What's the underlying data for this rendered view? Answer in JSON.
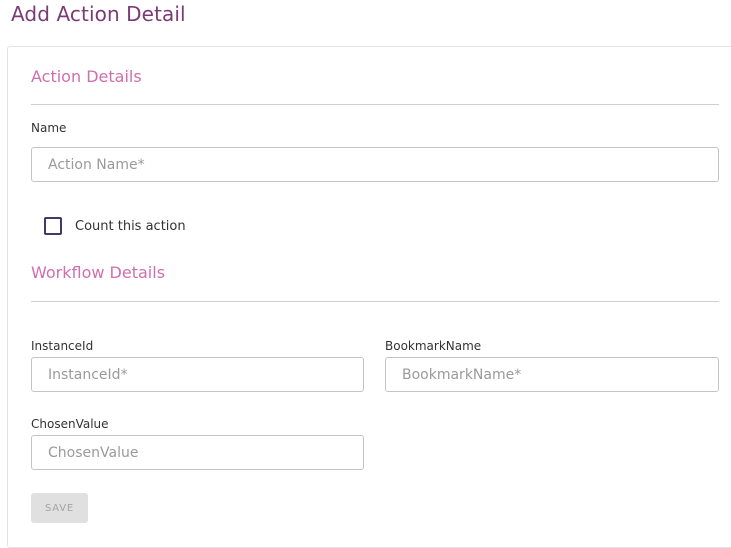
{
  "page": {
    "title": "Add Action Detail"
  },
  "action_details": {
    "heading": "Action Details",
    "name_label": "Name",
    "name_value": "",
    "name_placeholder": "Action Name*",
    "count_checkbox_label": "Count this action",
    "count_checked": false
  },
  "workflow_details": {
    "heading": "Workflow Details",
    "instance_id_label": "InstanceId",
    "instance_id_value": "",
    "instance_id_placeholder": "InstanceId*",
    "bookmark_name_label": "BookmarkName",
    "bookmark_name_value": "",
    "bookmark_name_placeholder": "BookmarkName*",
    "chosen_value_label": "ChosenValue",
    "chosen_value_value": "",
    "chosen_value_placeholder": "ChosenValue"
  },
  "actions": {
    "save_label": "SAVE",
    "save_disabled": true
  },
  "colors": {
    "title": "#7a3b74",
    "section_heading": "#cf6fae",
    "checkbox_border": "#3f3a66",
    "disabled_button_bg": "#e0e0e0",
    "disabled_button_text": "#a3a3a3"
  }
}
